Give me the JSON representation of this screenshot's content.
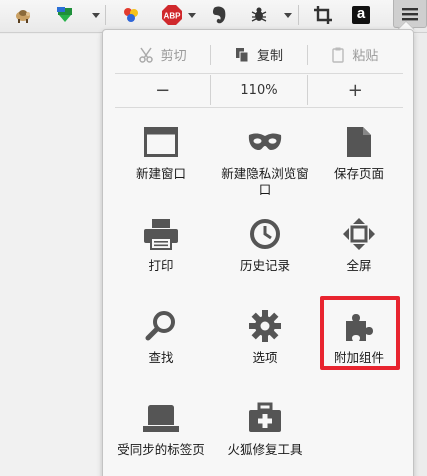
{
  "toolbar": {
    "icons": [
      "sheep-icon",
      "download-icon",
      "colorful-ball-icon",
      "adblock-plus-icon",
      "evernote-icon",
      "bug-icon",
      "crop-icon",
      "amazon-icon",
      "hamburger-menu-icon"
    ],
    "abp_label": "ABP",
    "amazon_label": "a"
  },
  "edit": {
    "cut": "剪切",
    "copy": "复制",
    "paste": "粘贴"
  },
  "zoom": {
    "minus": "−",
    "value": "110%",
    "plus": "+"
  },
  "items": [
    {
      "label": "新建窗口",
      "icon": "window-icon"
    },
    {
      "label": "新建隐私浏览窗口",
      "icon": "mask-icon"
    },
    {
      "label": "保存页面",
      "icon": "page-icon"
    },
    {
      "label": "打印",
      "icon": "printer-icon"
    },
    {
      "label": "历史记录",
      "icon": "clock-icon"
    },
    {
      "label": "全屏",
      "icon": "fullscreen-icon"
    },
    {
      "label": "查找",
      "icon": "magnifier-icon"
    },
    {
      "label": "选项",
      "icon": "gear-icon"
    },
    {
      "label": "附加组件",
      "icon": "puzzle-icon"
    },
    {
      "label": "受同步的标签页",
      "icon": "synced-tabs-icon"
    },
    {
      "label": "火狐修复工具",
      "icon": "repair-kit-icon"
    }
  ],
  "colors": {
    "icon_gray": "#555555",
    "highlight": "#e8242f",
    "abp_red": "#d0282c"
  }
}
